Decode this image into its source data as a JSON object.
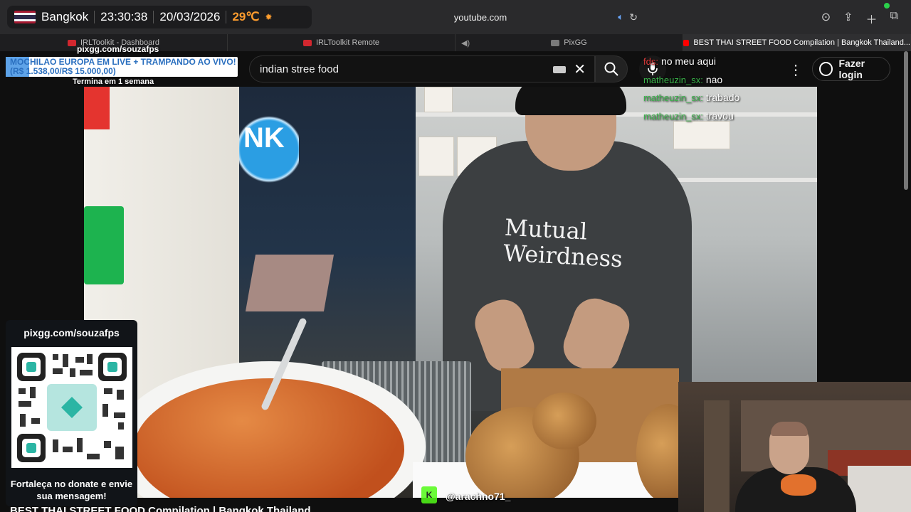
{
  "hud": {
    "city": "Bangkok",
    "time": "23:30:38",
    "date": "20/03/2026",
    "temperature": "29℃",
    "flag_colors": [
      "#a51931",
      "#f4f5f8",
      "#2d2a4a",
      "#f4f5f8",
      "#a51931"
    ]
  },
  "browser": {
    "address": "youtube.com",
    "icons": [
      "download-icon",
      "share-icon",
      "new-tab-icon",
      "tabs-overview-icon"
    ]
  },
  "tabs": [
    {
      "label": "IRLToolkit - Dashboard",
      "favicon_color": "#d2272f",
      "active": false
    },
    {
      "label": "IRLToolkit Remote",
      "favicon_color": "#d2272f",
      "active": false
    },
    {
      "label": "PixGG",
      "favicon_color": "#7a7a7a",
      "active": false
    },
    {
      "label": "BEST THAI STREET FOOD Compilation | Bangkok Thailand...",
      "favicon_color": "#ff0000",
      "active": true
    }
  ],
  "youtube": {
    "search_value": "indian stree food",
    "login_label": "Fazer login"
  },
  "donation_goal": {
    "title": "MOCHILAO EUROPA EM LIVE + TRAMPANDO AO VIVO! (R$ 1.538,00/R$ 15.000,00)",
    "url": "pixgg.com/souzafps",
    "ends": "Termina em 1 semana",
    "progress_fraction": 0.1025,
    "bar_color": "#5ea3e8"
  },
  "video": {
    "shirt_line1": "Mutual",
    "shirt_line2": "Weirdness",
    "sign_text": "NK"
  },
  "chat": [
    {
      "user": "fds:",
      "text": "no meu aqui",
      "color": "red"
    },
    {
      "user": "matheuzin_sx:",
      "text": "nao",
      "color": "green"
    },
    {
      "user": "matheuzin_sx:",
      "text": "trabado",
      "color": "green"
    },
    {
      "user": "matheuzin_sx:",
      "text": "travou",
      "color": "green"
    }
  ],
  "qr_panel": {
    "url": "pixgg.com/souzafps",
    "caption": "Fortaleça no donate e envie sua mensagem!"
  },
  "kick": {
    "handle": "@arachno71_",
    "badge": "K"
  },
  "bottom_title": "BEST THAI STREET FOOD Compilation | Bangkok Thailand"
}
